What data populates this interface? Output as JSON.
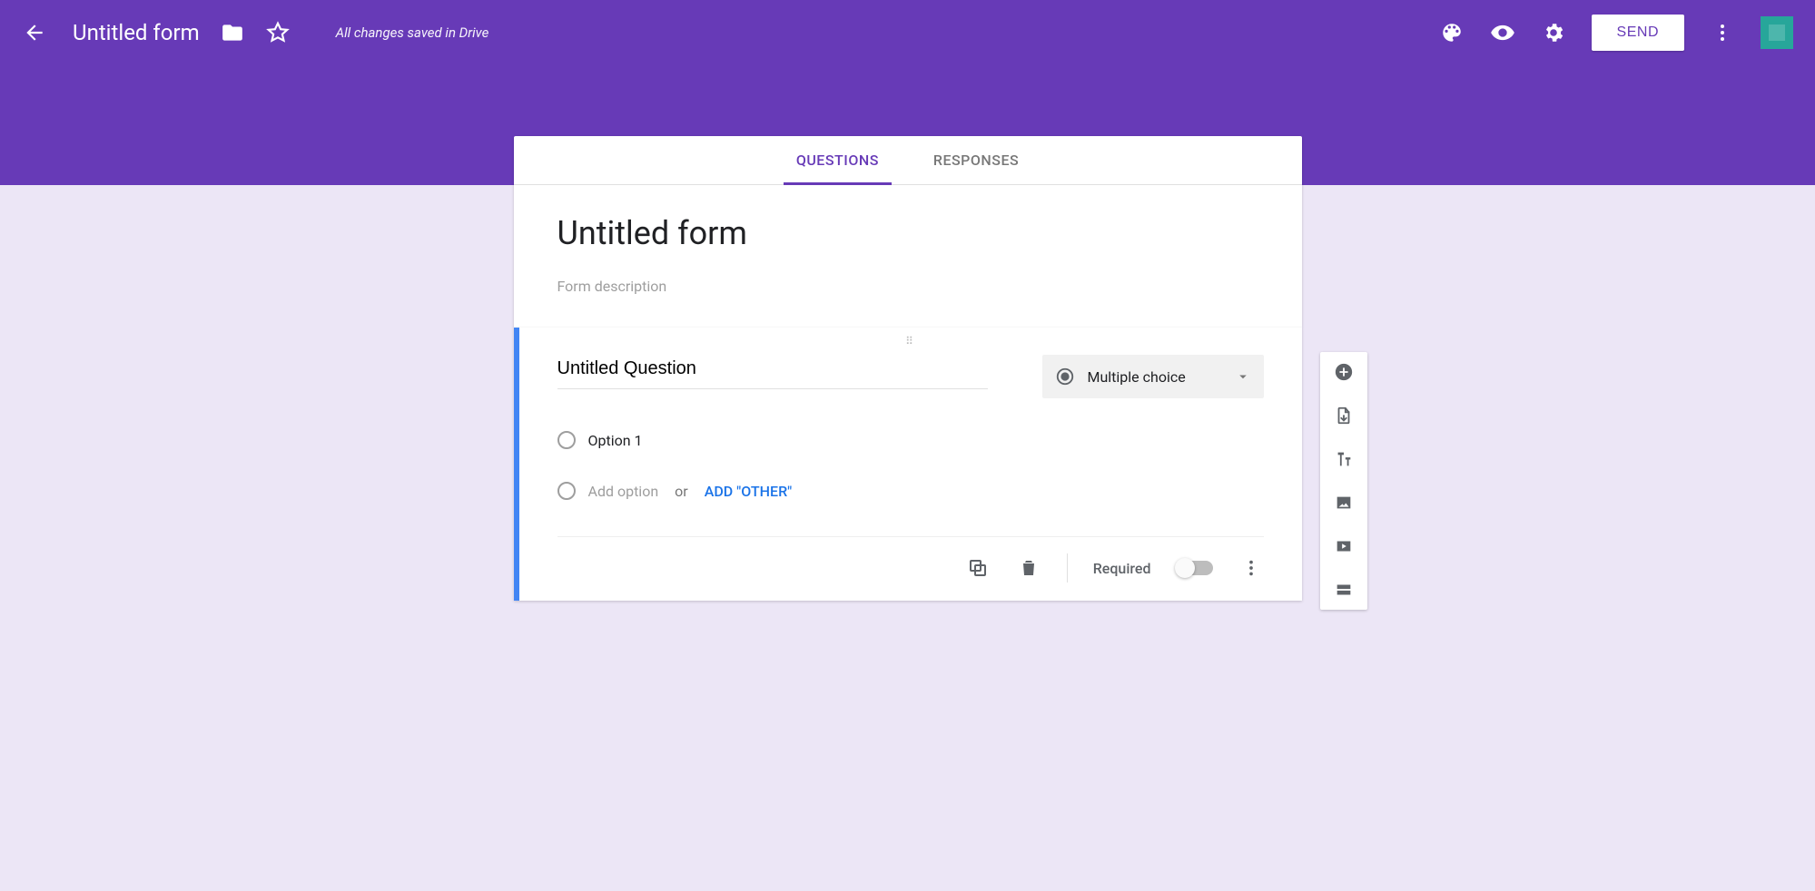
{
  "header": {
    "title": "Untitled form",
    "save_status": "All changes saved in Drive",
    "send_label": "SEND"
  },
  "tabs": {
    "questions": "QUESTIONS",
    "responses": "RESPONSES"
  },
  "form": {
    "title": "Untitled form",
    "description_placeholder": "Form description"
  },
  "question": {
    "title_value": "Untitled Question",
    "type_label": "Multiple choice",
    "option1": "Option 1",
    "add_option_label": "Add option",
    "or_label": "or",
    "add_other_label": "ADD \"OTHER\"",
    "required_label": "Required"
  }
}
